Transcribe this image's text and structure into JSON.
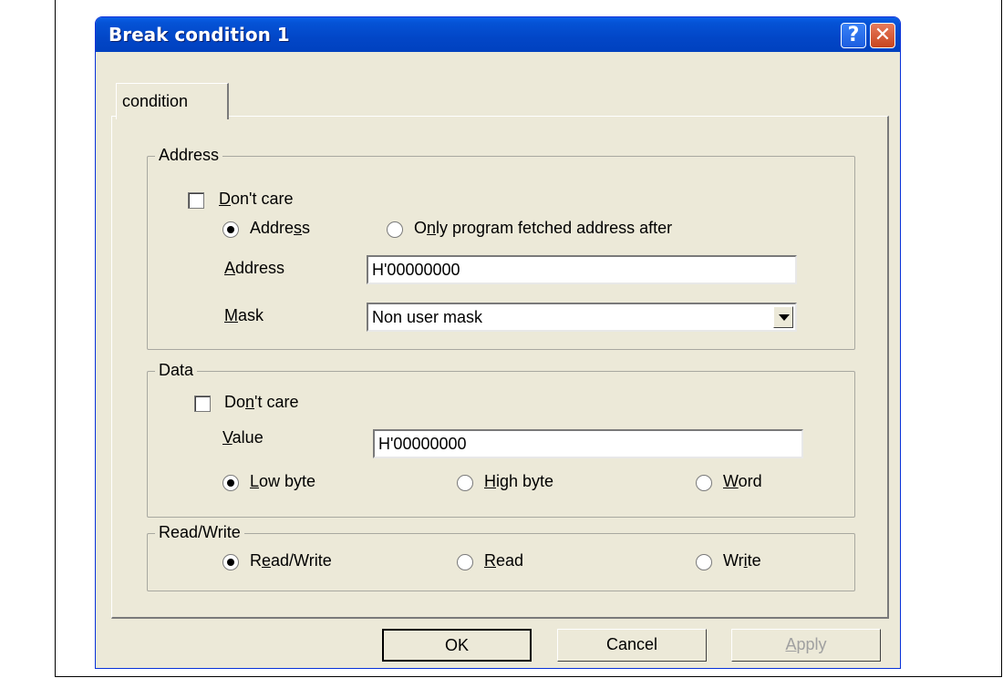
{
  "window": {
    "title": "Break condition 1",
    "help_label": "?",
    "close_label": "✕"
  },
  "tabs": [
    {
      "label": "condition",
      "selected": true
    }
  ],
  "address_group": {
    "title": "Address",
    "dont_care": {
      "label_u": "D",
      "label_rest": "on't care",
      "checked": false
    },
    "radio_address": {
      "label_pre": "Addre",
      "label_u": "s",
      "label_post": "s",
      "selected": true
    },
    "radio_program": {
      "label_pre": "O",
      "label_u": "n",
      "label_post": "ly program fetched address after",
      "selected": false
    },
    "address_label": {
      "label_u": "A",
      "label_rest": "ddress"
    },
    "address_value": "H'00000000",
    "mask_label": {
      "label_u": "M",
      "label_rest": "ask"
    },
    "mask_value": "Non user mask"
  },
  "data_group": {
    "title": "Data",
    "dont_care": {
      "label_pre": "Do",
      "label_u": "n",
      "label_post": "'t care",
      "checked": false
    },
    "value_label": {
      "label_u": "V",
      "label_rest": "alue"
    },
    "value": "H'00000000",
    "low_byte": {
      "label_u": "L",
      "label_rest": "ow byte",
      "selected": true
    },
    "high_byte": {
      "label_u": "H",
      "label_rest": "igh byte",
      "selected": false
    },
    "word": {
      "label_u": "W",
      "label_rest": "ord",
      "selected": false
    }
  },
  "rw_group": {
    "title": "Read/Write",
    "read_write": {
      "label_pre": "R",
      "label_u": "e",
      "label_post": "ad/Write",
      "selected": true
    },
    "read": {
      "label_u": "R",
      "label_rest": "ead",
      "selected": false
    },
    "write": {
      "label_pre": "Wr",
      "label_u": "i",
      "label_post": "te",
      "selected": false
    }
  },
  "buttons": {
    "ok": "OK",
    "cancel": "Cancel",
    "apply_u": "A",
    "apply_rest": "pply"
  },
  "colors": {
    "titlebar": "#0246c7",
    "dialog_bg": "#ece9d8",
    "close": "#c8451e"
  }
}
